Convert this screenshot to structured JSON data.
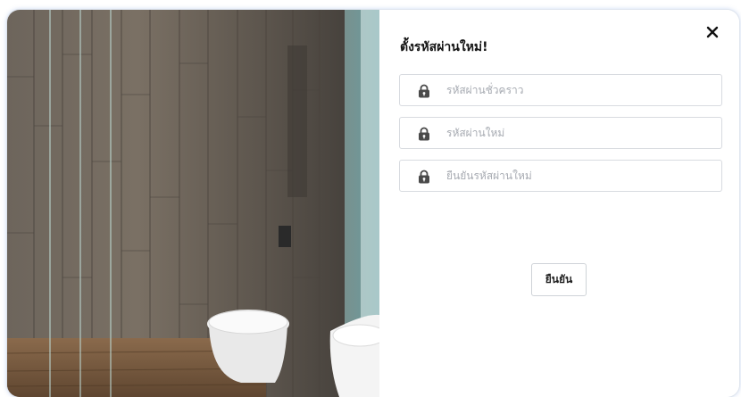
{
  "dialog": {
    "title": "ตั้งรหัสผ่านใหม่!",
    "fields": [
      {
        "placeholder": "รหัสผ่านชั่วคราว",
        "value": ""
      },
      {
        "placeholder": "รหัสผ่านใหม่",
        "value": ""
      },
      {
        "placeholder": "ยืนยันรหัสผ่านใหม่",
        "value": ""
      }
    ],
    "confirm_label": "ยืนยัน",
    "icons": {
      "close": "close-icon",
      "field": "lock-icon"
    },
    "colors": {
      "accent_border": "#3c6ec8",
      "field_border": "#d8dbe0",
      "placeholder": "#a7abb2"
    }
  }
}
